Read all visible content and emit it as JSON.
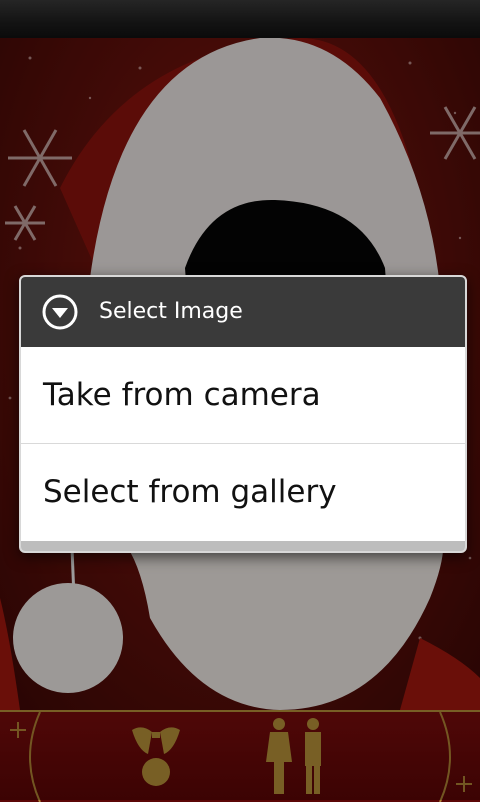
{
  "dialog": {
    "title": "Select Image",
    "icon": "chevron-down-circle-icon",
    "options": [
      {
        "label": "Take from camera"
      },
      {
        "label": "Select from gallery"
      }
    ]
  },
  "bottom_bar": {
    "icons": [
      "bells-icon",
      "gender-icon"
    ]
  },
  "colors": {
    "background_red": "#7a1510",
    "dialog_header": "#3a3a3a",
    "bottom_bar": "#6c0808",
    "gold_accent": "#b9933a"
  }
}
